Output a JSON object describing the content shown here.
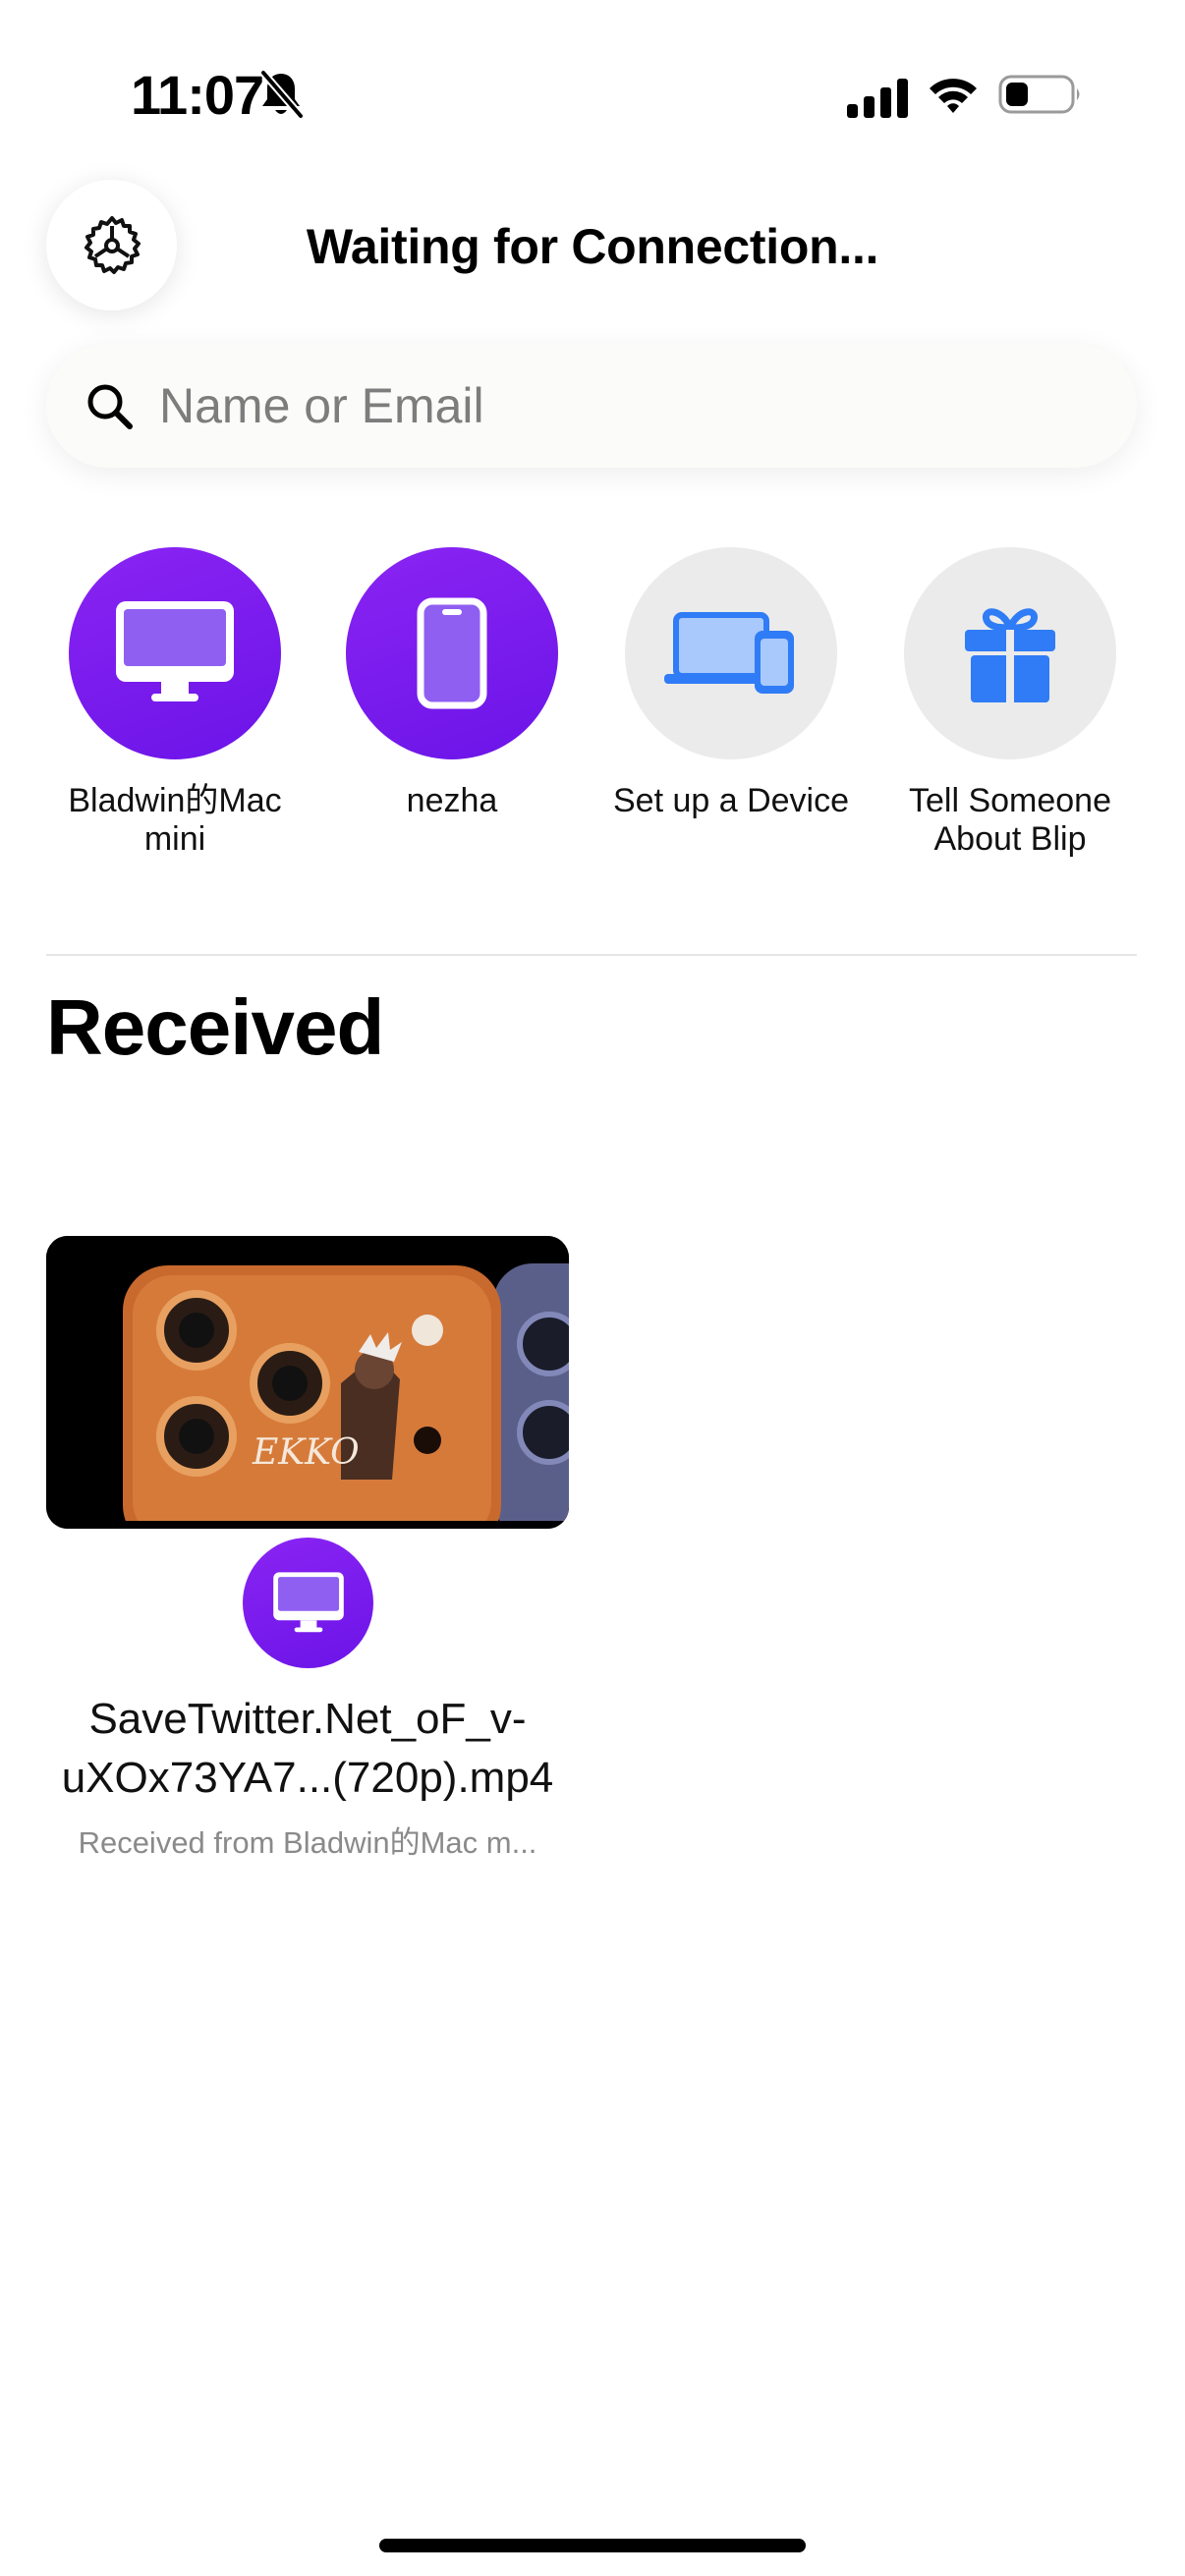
{
  "status_bar": {
    "time": "11:07",
    "icons": [
      "bell-slash-icon",
      "cellular-signal-icon",
      "wifi-icon",
      "battery-icon"
    ]
  },
  "header": {
    "title": "Waiting for Connection...",
    "settings_icon": "gear-icon"
  },
  "search": {
    "placeholder": "Name or Email",
    "value": ""
  },
  "devices": [
    {
      "label": "Bladwin的Mac mini",
      "icon": "desktop-icon"
    },
    {
      "label": "nezha",
      "icon": "phone-icon"
    },
    {
      "label": "Set up a Device",
      "icon": "devices-icon"
    },
    {
      "label": "Tell Someone About Blip",
      "icon": "gift-icon"
    }
  ],
  "received": {
    "title": "Received",
    "items": [
      {
        "file_name": "SaveTwitter.Net_oF_v-uXOx73YA7...(720p).mp4",
        "meta": "Received from Bladwin的Mac m...",
        "sender_icon": "desktop-icon",
        "thumbnail_text": "EKKO"
      }
    ]
  },
  "colors": {
    "accent_purple": "#7a1cf0",
    "accent_blue": "#2f7cf6",
    "neutral_circle": "#ebebeb"
  }
}
